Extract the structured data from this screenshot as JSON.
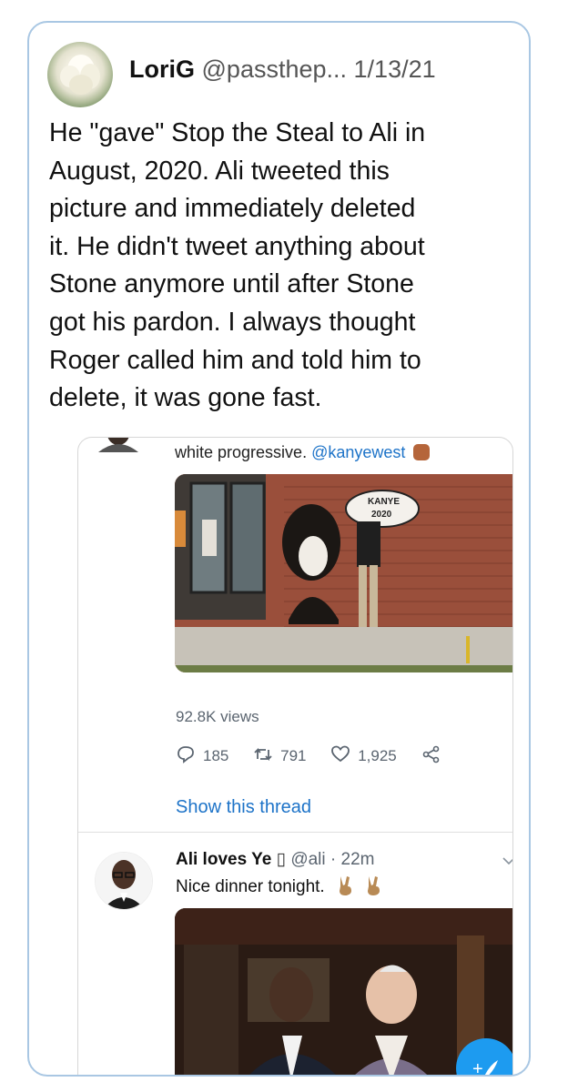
{
  "tweet": {
    "name": "LoriG",
    "handle": "@passthep...",
    "date": "1/13/21",
    "text": "He \"gave\" Stop the Steal to Ali in\nAugust, 2020. Ali tweeted this\npicture and immediately deleted\nit. He didn't tweet anything about\nStone anymore until after Stone\ngot his pardon. I always thought\nRoger called him and told him to\ndelete, it was gone fast."
  },
  "embedded": {
    "top_text": "white progressive.",
    "top_mention": "@kanyewest",
    "sign_text": "KANYE\n2020",
    "views": "92.8K views",
    "replies": "185",
    "retweets": "791",
    "likes": "1,925",
    "show_thread": "Show this thread",
    "reply": {
      "name": "Ali loves Ye",
      "verified_glyph": "▯",
      "handle": "@ali",
      "separator": "·",
      "time": "22m",
      "text": "Nice dinner tonight."
    }
  },
  "icons": [
    "reply-icon",
    "retweet-icon",
    "like-icon",
    "share-icon",
    "chevron-down-icon",
    "compose-icon"
  ],
  "colors": {
    "link": "#1d73c8",
    "card_border": "#a9c7e3",
    "fab": "#1d9bf0",
    "meta": "#5b6570"
  }
}
